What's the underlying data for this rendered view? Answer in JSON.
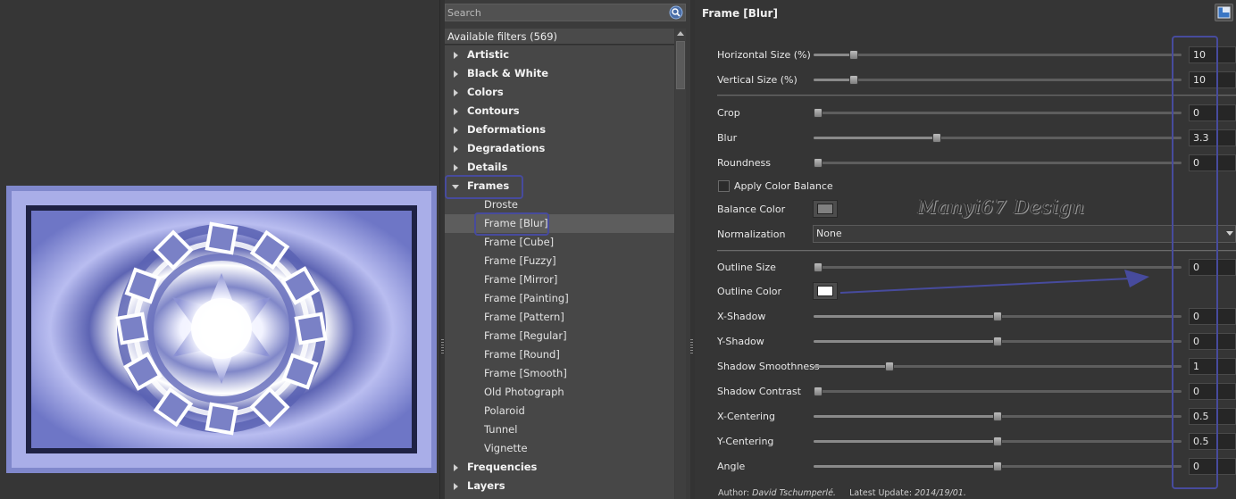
{
  "search": {
    "placeholder": "Search"
  },
  "tree": {
    "header": "Available filters (569)",
    "rows": [
      {
        "label": "Artistic",
        "kind": "cat"
      },
      {
        "label": "Black & White",
        "kind": "cat"
      },
      {
        "label": "Colors",
        "kind": "cat"
      },
      {
        "label": "Contours",
        "kind": "cat"
      },
      {
        "label": "Deformations",
        "kind": "cat"
      },
      {
        "label": "Degradations",
        "kind": "cat"
      },
      {
        "label": "Details",
        "kind": "cat"
      },
      {
        "label": "Frames",
        "kind": "cat",
        "open": true
      },
      {
        "label": "Droste",
        "kind": "sub"
      },
      {
        "label": "Frame [Blur]",
        "kind": "sub",
        "selected": true
      },
      {
        "label": "Frame [Cube]",
        "kind": "sub"
      },
      {
        "label": "Frame [Fuzzy]",
        "kind": "sub"
      },
      {
        "label": "Frame [Mirror]",
        "kind": "sub"
      },
      {
        "label": "Frame [Painting]",
        "kind": "sub"
      },
      {
        "label": "Frame [Pattern]",
        "kind": "sub"
      },
      {
        "label": "Frame [Regular]",
        "kind": "sub"
      },
      {
        "label": "Frame [Round]",
        "kind": "sub"
      },
      {
        "label": "Frame [Smooth]",
        "kind": "sub"
      },
      {
        "label": "Old Photograph",
        "kind": "sub"
      },
      {
        "label": "Polaroid",
        "kind": "sub"
      },
      {
        "label": "Tunnel",
        "kind": "sub"
      },
      {
        "label": "Vignette",
        "kind": "sub"
      },
      {
        "label": "Frequencies",
        "kind": "cat"
      },
      {
        "label": "Layers",
        "kind": "cat"
      }
    ]
  },
  "params": {
    "title": "Frame [Blur]",
    "horizontal_size": {
      "label": "Horizontal Size (%)",
      "value": "10",
      "fraction": 0.1
    },
    "vertical_size": {
      "label": "Vertical Size (%)",
      "value": "10",
      "fraction": 0.1
    },
    "crop": {
      "label": "Crop",
      "value": "0",
      "fraction": 0.0
    },
    "blur": {
      "label": "Blur",
      "value": "3.3",
      "fraction": 0.33
    },
    "roundness": {
      "label": "Roundness",
      "value": "0",
      "fraction": 0.0
    },
    "apply_color_balance": {
      "label": "Apply Color Balance",
      "checked": false
    },
    "balance_color": {
      "label": "Balance Color",
      "color": "#808080"
    },
    "normalization": {
      "label": "Normalization",
      "value": "None"
    },
    "outline_size": {
      "label": "Outline Size",
      "value": "0",
      "fraction": 0.0
    },
    "outline_color": {
      "label": "Outline Color",
      "color": "#ffffff"
    },
    "x_shadow": {
      "label": "X-Shadow",
      "value": "0",
      "fraction": 0.5
    },
    "y_shadow": {
      "label": "Y-Shadow",
      "value": "0",
      "fraction": 0.5
    },
    "shadow_smoothness": {
      "label": "Shadow Smoothness",
      "value": "1",
      "fraction": 0.2
    },
    "shadow_contrast": {
      "label": "Shadow Contrast",
      "value": "0",
      "fraction": 0.0
    },
    "x_centering": {
      "label": "X-Centering",
      "value": "0.5",
      "fraction": 0.5
    },
    "y_centering": {
      "label": "Y-Centering",
      "value": "0.5",
      "fraction": 0.5
    },
    "angle": {
      "label": "Angle",
      "value": "0",
      "fraction": 0.5
    },
    "author_prefix": "Author:",
    "author_name": "David Tschumperlé.",
    "update_prefix": "Latest Update:",
    "update_date": "2014/19/01."
  },
  "watermark": "Manyi67 Design",
  "colors": {
    "highlight": "#474b9d",
    "preview_border": "#8088cc"
  }
}
